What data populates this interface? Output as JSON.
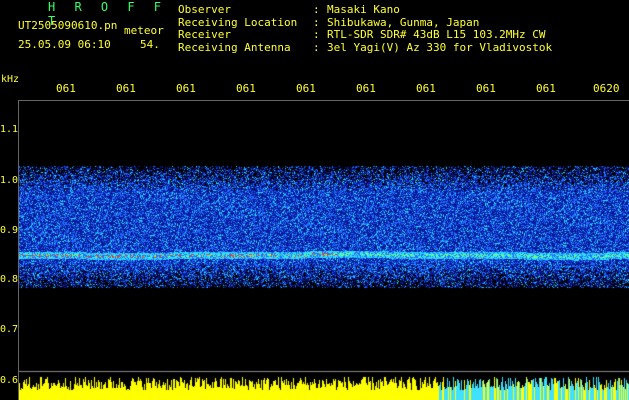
{
  "header": {
    "brand": "H R O F F T",
    "filename": "UT2505090610.pn",
    "meteor": "meteor",
    "datetime": "25.05.09 06:10",
    "value": "54."
  },
  "info": [
    {
      "key": "Observer",
      "value": "Masaki Kano"
    },
    {
      "key": "Receiving Location",
      "value": "Shibukawa, Gunma, Japan"
    },
    {
      "key": "Receiver",
      "value": "RTL-SDR SDR# 43dB L15 103.2MHz CW"
    },
    {
      "key": "Receiving Antenna",
      "value": "3el Yagi(V) Az 330 for Vladivostok"
    }
  ],
  "axis": {
    "unit": "kHz",
    "y_labels": [
      "1.1",
      "1.0",
      "0.9",
      "0.8",
      "0.7",
      "0.6"
    ],
    "time_labels": [
      "061",
      "061",
      "061",
      "061",
      "061",
      "061",
      "061",
      "061",
      "061",
      "0620"
    ]
  },
  "colors": {
    "text": "#ffff33",
    "brand": "#33ff66",
    "background": "#000000",
    "noise_low": "#0a1a9a",
    "noise_mid": "#1e6cff",
    "noise_high": "#29e0ff",
    "peak": "#ff3322",
    "bottom_bars": "#ffff00",
    "bottom_bars_right": "#40e0ff"
  }
}
